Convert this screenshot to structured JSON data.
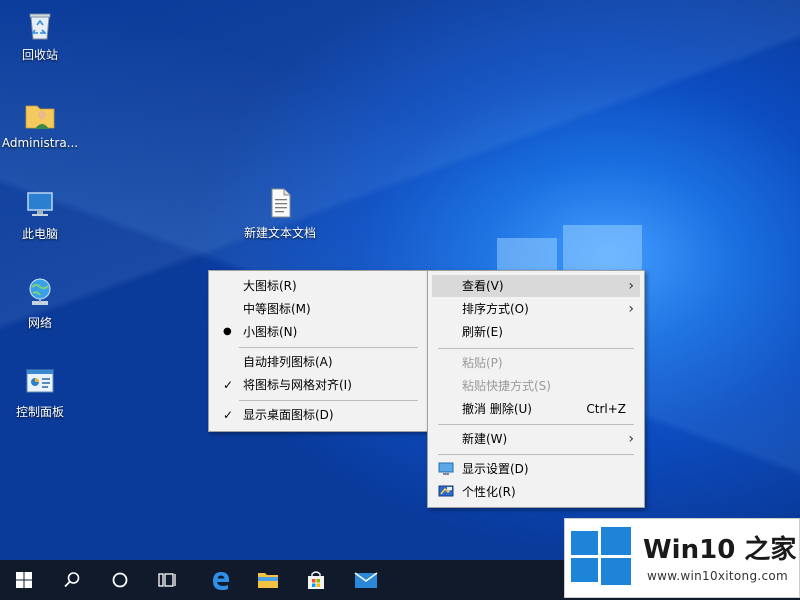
{
  "desktop_icons": [
    {
      "label": "回收站",
      "icon": "recycle-bin-icon"
    },
    {
      "label": "Administra...",
      "icon": "user-folder-icon"
    },
    {
      "label": "此电脑",
      "icon": "computer-icon"
    },
    {
      "label": "网络",
      "icon": "network-icon"
    },
    {
      "label": "控制面板",
      "icon": "control-panel-icon"
    },
    {
      "label": "新建文本文档",
      "icon": "text-document-icon"
    }
  ],
  "view_submenu": {
    "items": [
      {
        "label": "大图标(R)",
        "mark": ""
      },
      {
        "label": "中等图标(M)",
        "mark": ""
      },
      {
        "label": "小图标(N)",
        "mark": "●"
      },
      {
        "label": "自动排列图标(A)",
        "mark": ""
      },
      {
        "label": "将图标与网格对齐(I)",
        "mark": "✓"
      },
      {
        "label": "显示桌面图标(D)",
        "mark": "✓"
      }
    ]
  },
  "context_menu": {
    "items": [
      {
        "label": "查看(V)",
        "has_submenu": true,
        "highlighted": true
      },
      {
        "label": "排序方式(O)",
        "has_submenu": true
      },
      {
        "label": "刷新(E)"
      },
      {
        "label": "粘贴(P)",
        "disabled": true
      },
      {
        "label": "粘贴快捷方式(S)",
        "disabled": true
      },
      {
        "label": "撤消 删除(U)",
        "shortcut": "Ctrl+Z"
      },
      {
        "label": "新建(W)",
        "has_submenu": true
      },
      {
        "label": "显示设置(D)",
        "icon": "display-settings-icon"
      },
      {
        "label": "个性化(R)",
        "icon": "personalize-icon"
      }
    ]
  },
  "taskbar": {
    "items": [
      "start-icon",
      "search-icon",
      "cortana-icon",
      "task-view-icon",
      "edge-icon",
      "file-explorer-icon",
      "store-icon",
      "mail-icon"
    ]
  },
  "watermark": {
    "title": "Win10 之家",
    "url": "www.win10xitong.com"
  },
  "colors": {
    "accent": "#1e84d8",
    "taskbar": "#101a2a",
    "menu_bg": "#f2f2f2"
  }
}
